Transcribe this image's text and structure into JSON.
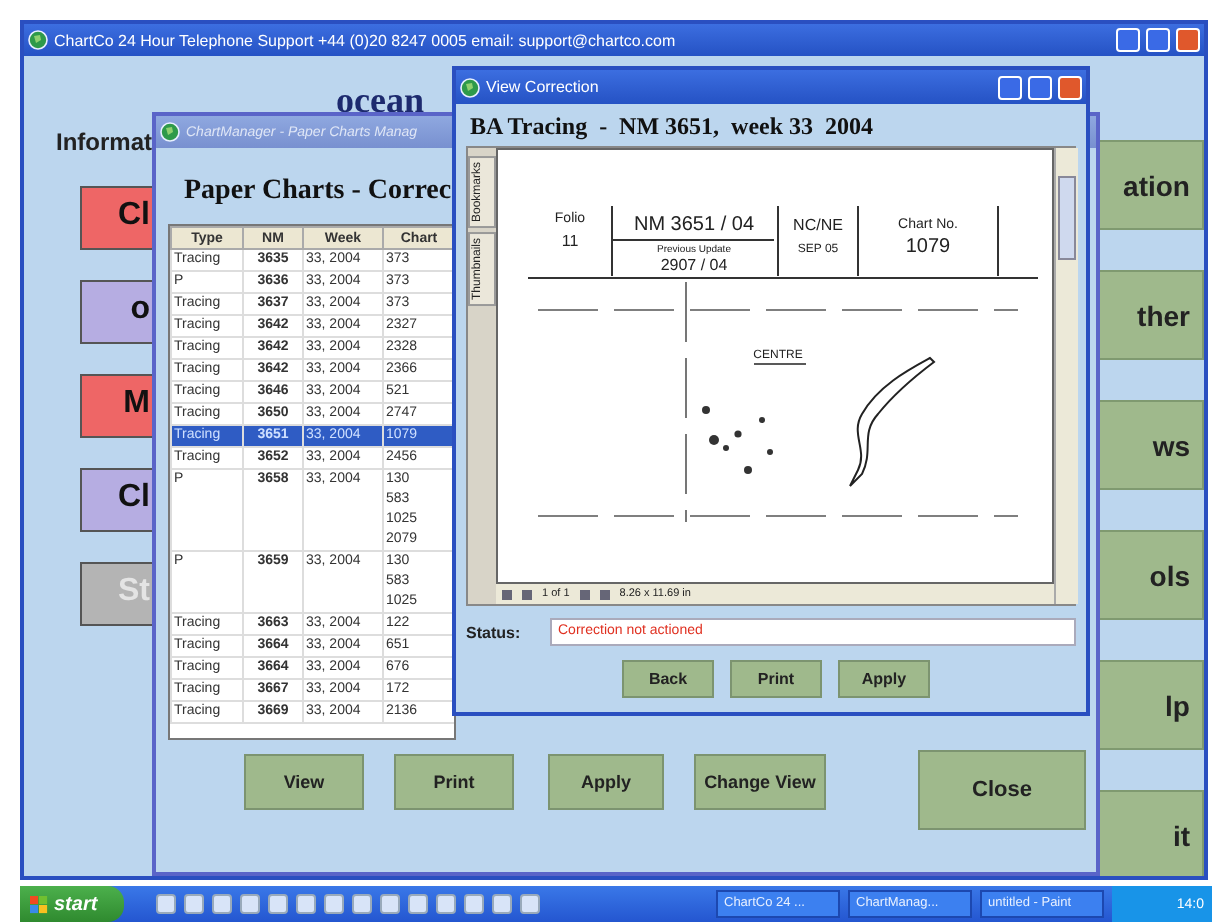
{
  "main_window": {
    "title": "ChartCo 24 Hour Telephone Support +44 (0)20 8247 0005 email: support@chartco.com",
    "heading": "ocean",
    "section_label": "Informat",
    "left_buttons": [
      {
        "label": "Cl",
        "color": "#ee6666",
        "disabled": false
      },
      {
        "label": "o",
        "color": "#b6ade2",
        "disabled": false
      },
      {
        "label": "M",
        "color": "#ee6666",
        "disabled": false
      },
      {
        "label": "Cl",
        "color": "#b6ade2",
        "disabled": false
      },
      {
        "label": "St",
        "color": "#b4b4b4",
        "disabled": true
      }
    ],
    "right_buttons": [
      "ation",
      "ther",
      "ws",
      "ols",
      "lp",
      "it"
    ]
  },
  "chart_manager": {
    "title": "ChartManager - Paper Charts Manag",
    "heading": "Paper Charts - Correc",
    "table": {
      "columns": [
        "Type",
        "NM",
        "Week",
        "Chart"
      ],
      "rows": [
        {
          "type": "Tracing",
          "nm": "3635",
          "week": "33, 2004",
          "chart": [
            "373"
          ],
          "selected": false
        },
        {
          "type": "P",
          "nm": "3636",
          "week": "33, 2004",
          "chart": [
            "373"
          ],
          "selected": false
        },
        {
          "type": "Tracing",
          "nm": "3637",
          "week": "33, 2004",
          "chart": [
            "373"
          ],
          "selected": false
        },
        {
          "type": "Tracing",
          "nm": "3642",
          "week": "33, 2004",
          "chart": [
            "2327"
          ],
          "selected": false
        },
        {
          "type": "Tracing",
          "nm": "3642",
          "week": "33, 2004",
          "chart": [
            "2328"
          ],
          "selected": false
        },
        {
          "type": "Tracing",
          "nm": "3642",
          "week": "33, 2004",
          "chart": [
            "2366"
          ],
          "selected": false
        },
        {
          "type": "Tracing",
          "nm": "3646",
          "week": "33, 2004",
          "chart": [
            "521"
          ],
          "selected": false
        },
        {
          "type": "Tracing",
          "nm": "3650",
          "week": "33, 2004",
          "chart": [
            "2747"
          ],
          "selected": false
        },
        {
          "type": "Tracing",
          "nm": "3651",
          "week": "33, 2004",
          "chart": [
            "1079"
          ],
          "selected": true
        },
        {
          "type": "Tracing",
          "nm": "3652",
          "week": "33, 2004",
          "chart": [
            "2456"
          ],
          "selected": false
        },
        {
          "type": "P",
          "nm": "3658",
          "week": "33, 2004",
          "chart": [
            "130",
            "583",
            "1025",
            "2079"
          ],
          "selected": false
        },
        {
          "type": "P",
          "nm": "3659",
          "week": "33, 2004",
          "chart": [
            "130",
            "583",
            "1025"
          ],
          "selected": false
        },
        {
          "type": "Tracing",
          "nm": "3663",
          "week": "33, 2004",
          "chart": [
            "122"
          ],
          "selected": false
        },
        {
          "type": "Tracing",
          "nm": "3664",
          "week": "33, 2004",
          "chart": [
            "651"
          ],
          "selected": false
        },
        {
          "type": "Tracing",
          "nm": "3664",
          "week": "33, 2004",
          "chart": [
            "676"
          ],
          "selected": false
        },
        {
          "type": "Tracing",
          "nm": "3667",
          "week": "33, 2004",
          "chart": [
            "172"
          ],
          "selected": false
        },
        {
          "type": "Tracing",
          "nm": "3669",
          "week": "33, 2004",
          "chart": [
            "2136"
          ],
          "selected": false
        }
      ]
    },
    "buttons": [
      "View",
      "Print",
      "Apply",
      "Change View"
    ],
    "close_button": "Close"
  },
  "view_correction": {
    "title": "View Correction",
    "heading": "BA Tracing  -  NM 3651,  week 33  2004",
    "side_tabs": [
      "Bookmarks",
      "Thumbnails"
    ],
    "document": {
      "folio_label": "Folio",
      "folio": "11",
      "nm": "NM 3651 / 04",
      "previous_update_label": "Previous Update",
      "previous_update": "2907 / 04",
      "area": "NC/NE",
      "area_date": "SEP 05",
      "chart_no_label": "Chart No.",
      "chart_no": "1079",
      "place": "CENTRE"
    },
    "page_indicator": "1 of 1",
    "page_size": "8.26 x 11.69 in",
    "status_label": "Status:",
    "status": "Correction not actioned",
    "buttons": [
      "Back",
      "Print",
      "Apply"
    ]
  },
  "taskbar": {
    "start": "start",
    "tasks": [
      "ChartCo 24 ...",
      "ChartManag...",
      "untitled - Paint"
    ],
    "clock": "14:0"
  }
}
